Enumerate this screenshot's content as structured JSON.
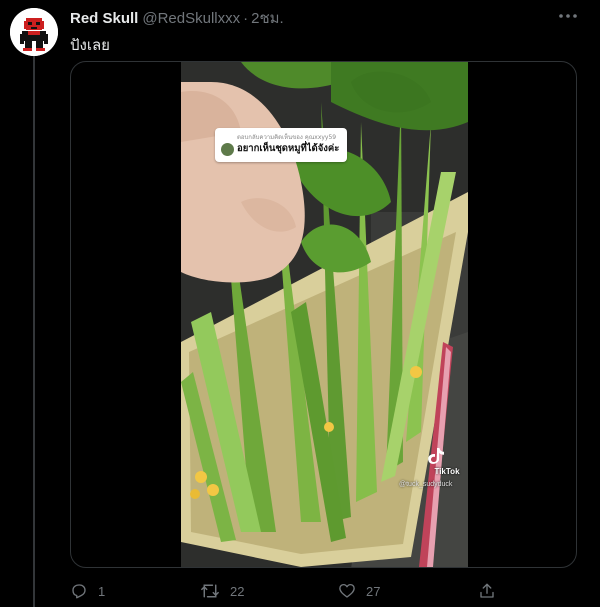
{
  "tweet": {
    "display_name": "Red Skull",
    "handle": "@RedSkullxxx",
    "separator": "·",
    "time": "2ชม.",
    "text": "ปังเลย"
  },
  "video": {
    "comment_reply_label": "ตอบกลับความคิดเห็นของ คุณxxyy59",
    "comment_text": "อยากเห็นชุดหมูที่ได้จังค่ะ",
    "watermark": "TikTok",
    "watermark_handle": "@tuck_sudyduck"
  },
  "actions": {
    "reply_count": "1",
    "retweet_count": "22",
    "like_count": "27"
  },
  "icons": {
    "more": "more-icon",
    "reply": "reply-icon",
    "retweet": "retweet-icon",
    "like": "heart-icon",
    "share": "share-icon"
  },
  "colors": {
    "background": "#000000",
    "text_primary": "#e7e9ea",
    "text_secondary": "#71767b",
    "border": "#2f3336",
    "avatar_red": "#cc1f1f"
  }
}
